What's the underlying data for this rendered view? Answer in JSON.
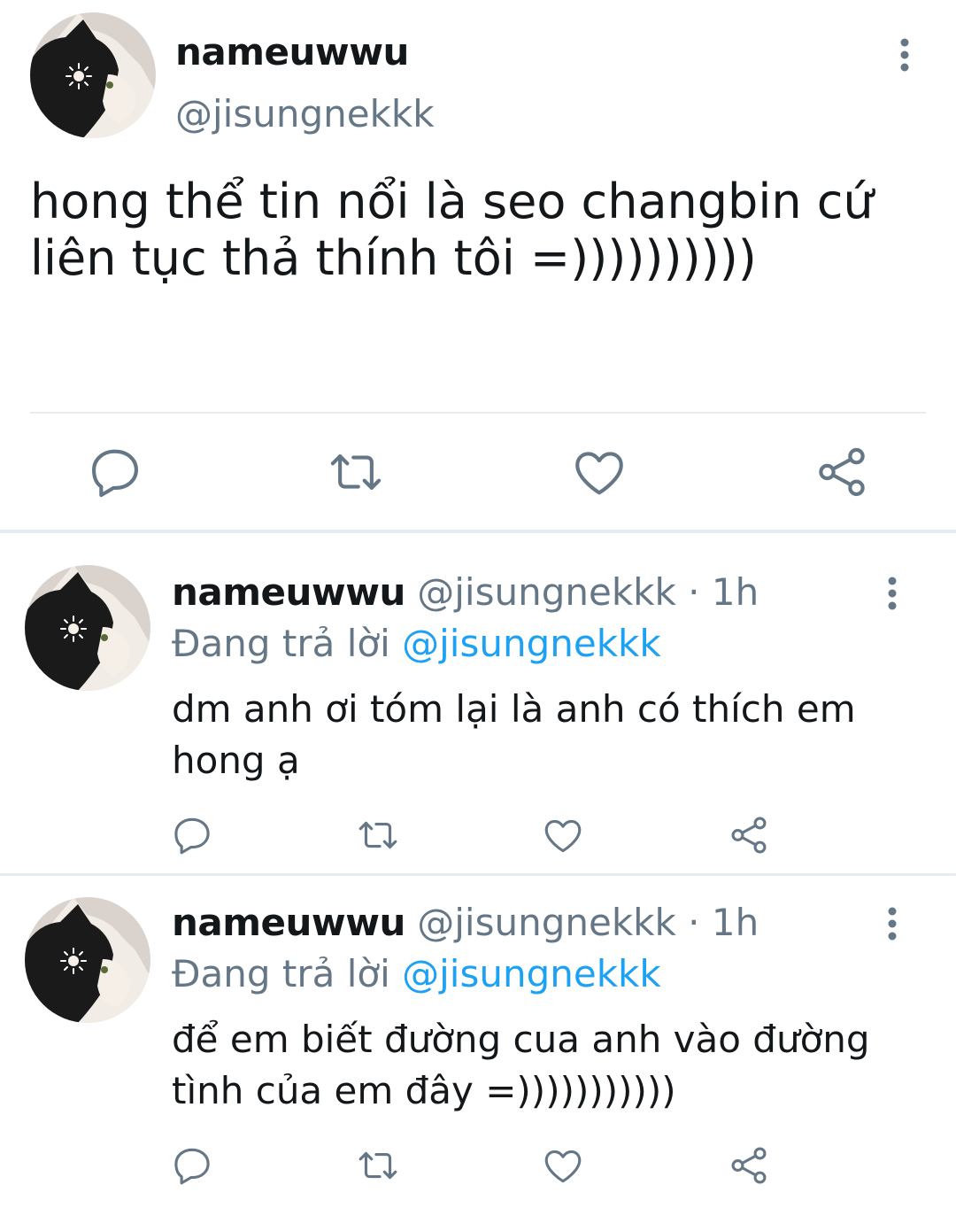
{
  "main_tweet": {
    "display_name": "nameuwwu",
    "handle": "@jisungnekkk",
    "text": "hong thể tin nổi là seo changbin cứ liên tục thả thính tôi =))))))))))",
    "icons": [
      "avatar-cat",
      "more-vertical-icon",
      "reply-icon",
      "retweet-icon",
      "like-icon",
      "share-icon"
    ]
  },
  "replies": [
    {
      "display_name": "nameuwwu",
      "handle_time": "@jisungnekkk · 1h",
      "replying_prefix": "Đang trả lời",
      "replying_to": "@jisungnekkk",
      "text": "dm anh ơi tóm lại là anh có thích em hong ạ"
    },
    {
      "display_name": "nameuwwu",
      "handle_time": "@jisungnekkk · 1h",
      "replying_prefix": "Đang trả lời",
      "replying_to": "@jisungnekkk",
      "text": "để em biết đường cua anh vào đường tình của em đây =)))))))))))"
    }
  ],
  "colors": {
    "text_primary": "#14171a",
    "text_secondary": "#657786",
    "link": "#1da1f2",
    "icon": "#657786",
    "divider": "#e6ecf0"
  }
}
